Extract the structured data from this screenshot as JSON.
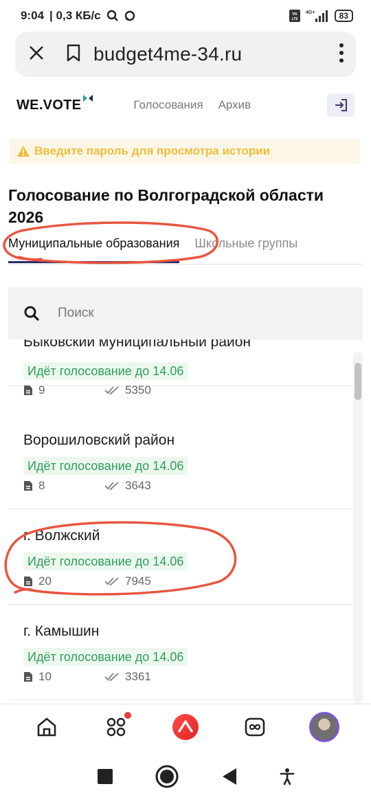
{
  "status_bar": {
    "time": "9:04",
    "speed": "| 0,3 КБ/с",
    "network": "4G+",
    "battery": "83"
  },
  "browser": {
    "url": "budget4me-34.ru"
  },
  "site": {
    "logo": "WE.VOTE",
    "nav": [
      "Голосования",
      "Архив"
    ]
  },
  "warning": {
    "text": "Введите пароль для просмотра истории"
  },
  "page": {
    "title": "Голосование по Волгоградской области 2026"
  },
  "tabs": [
    {
      "label": "Муниципальные образования",
      "active": true
    },
    {
      "label": "Школьные группы",
      "active": false
    }
  ],
  "search": {
    "placeholder": "Поиск"
  },
  "items": [
    {
      "title": "Быковский муниципальный район",
      "status": "Идёт голосование до 14.06",
      "docs": "9",
      "votes": "5350"
    },
    {
      "title": "Ворошиловский район",
      "status": "Идёт голосование до 14.06",
      "docs": "8",
      "votes": "3643"
    },
    {
      "title": "г. Волжский",
      "status": "Идёт голосование до 14.06",
      "docs": "20",
      "votes": "7945"
    },
    {
      "title": "г. Камышин",
      "status": "Идёт голосование до 14.06",
      "docs": "10",
      "votes": "3361"
    }
  ],
  "colors": {
    "accent_green": "#2e9e5c",
    "warning_yellow": "#f2bd3b",
    "annotation_red": "#e8553f",
    "tab_underline": "#2a2a6a"
  }
}
